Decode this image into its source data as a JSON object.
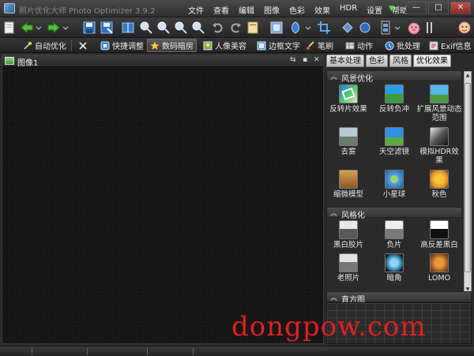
{
  "window": {
    "title": "照片优化大师 Photo Optimizer 3.9.2",
    "menu": [
      "文件",
      "查看",
      "编辑",
      "图像",
      "色彩",
      "效果",
      "HDR",
      "设置",
      "帮助"
    ],
    "controls": {
      "minimize": "—",
      "maximize": "□",
      "close": "✕"
    }
  },
  "tabbar": {
    "items": [
      {
        "label": "自动优化",
        "icon": "magic-wand-icon"
      },
      {
        "label": "",
        "icon": "tools-icon"
      },
      {
        "label": "快捷调整",
        "icon": "quick-adjust-icon"
      },
      {
        "label": "数码暗房",
        "icon": "star-icon",
        "active": true
      },
      {
        "label": "人像美容",
        "icon": "portrait-icon"
      },
      {
        "label": "边框文字",
        "icon": "frame-text-icon"
      },
      {
        "label": "笔刷",
        "icon": "brush-icon"
      },
      {
        "label": "动作",
        "icon": "action-icon"
      },
      {
        "label": "批处理",
        "icon": "batch-icon"
      },
      {
        "label": "Exif信息",
        "icon": "exif-icon"
      }
    ]
  },
  "document": {
    "tab_label": "图像1",
    "controls": [
      "⇆",
      "▪",
      "✕"
    ]
  },
  "right_panel": {
    "tabs": [
      {
        "label": "基本处理"
      },
      {
        "label": "色彩"
      },
      {
        "label": "风格"
      },
      {
        "label": "优化效果",
        "active": true
      }
    ],
    "sections": [
      {
        "title": "风景优化",
        "effects": [
          {
            "label": "反转片效果",
            "icon": "slide-film-icon"
          },
          {
            "label": "反转负冲",
            "icon": "cross-process-icon"
          },
          {
            "label": "扩展风景动态",
            "label2": "范围",
            "icon": "landscape-dynamic-icon"
          },
          {
            "label": "去雾",
            "icon": "dehaze-icon"
          },
          {
            "label": "天空滤镜",
            "icon": "sky-filter-icon"
          },
          {
            "label": "模拟HDR效",
            "label2": "果",
            "icon": "hdr-icon"
          },
          {
            "label": "缩微模型",
            "icon": "miniature-icon"
          },
          {
            "label": "小星球",
            "icon": "little-planet-icon"
          },
          {
            "label": "秋色",
            "icon": "autumn-icon"
          }
        ]
      },
      {
        "title": "风格化",
        "effects": [
          {
            "label": "黑白胶片",
            "icon": "bw-film-icon"
          },
          {
            "label": "负片",
            "icon": "negative-icon"
          },
          {
            "label": "高反差黑白",
            "icon": "high-contrast-bw-icon"
          },
          {
            "label": "老照片",
            "icon": "old-photo-icon"
          },
          {
            "label": "暗角",
            "icon": "vignette-icon"
          },
          {
            "label": "LOMO",
            "icon": "lomo-icon"
          }
        ]
      },
      {
        "title": "直方图",
        "effects": []
      }
    ]
  },
  "watermark": "dongpow.com"
}
